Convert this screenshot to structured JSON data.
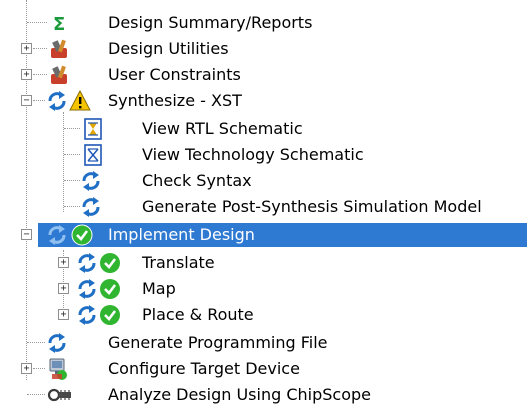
{
  "process_tree": {
    "items": [
      {
        "label": "Design Summary/Reports",
        "icon": "sigma-icon"
      },
      {
        "label": "Design Utilities",
        "icon": "tools-icon"
      },
      {
        "label": "User Constraints",
        "icon": "tools-icon"
      },
      {
        "label": "Synthesize - XST",
        "icon": "warning-icon"
      },
      {
        "label": "View RTL Schematic",
        "icon": "schematic-icon"
      },
      {
        "label": "View Technology Schematic",
        "icon": "schematic-icon"
      },
      {
        "label": "Check Syntax",
        "icon": "refresh-icon"
      },
      {
        "label": "Generate Post-Synthesis Simulation Model",
        "icon": "refresh-icon"
      },
      {
        "label": "Implement Design",
        "icon": "check-icon",
        "selected": true
      },
      {
        "label": "Translate",
        "icon": "check-icon"
      },
      {
        "label": "Map",
        "icon": "check-icon"
      },
      {
        "label": "Place & Route",
        "icon": "check-icon"
      },
      {
        "label": "Generate Programming File",
        "icon": "refresh-icon"
      },
      {
        "label": "Configure Target Device",
        "icon": "device-icon"
      },
      {
        "label": "Analyze Design Using ChipScope",
        "icon": "chipscope-icon"
      }
    ]
  },
  "colors": {
    "selection": "#2e79d1",
    "refresh_blue": "#1f6fc5",
    "check_green": "#2fb52f",
    "warning_yellow": "#f5c400"
  }
}
